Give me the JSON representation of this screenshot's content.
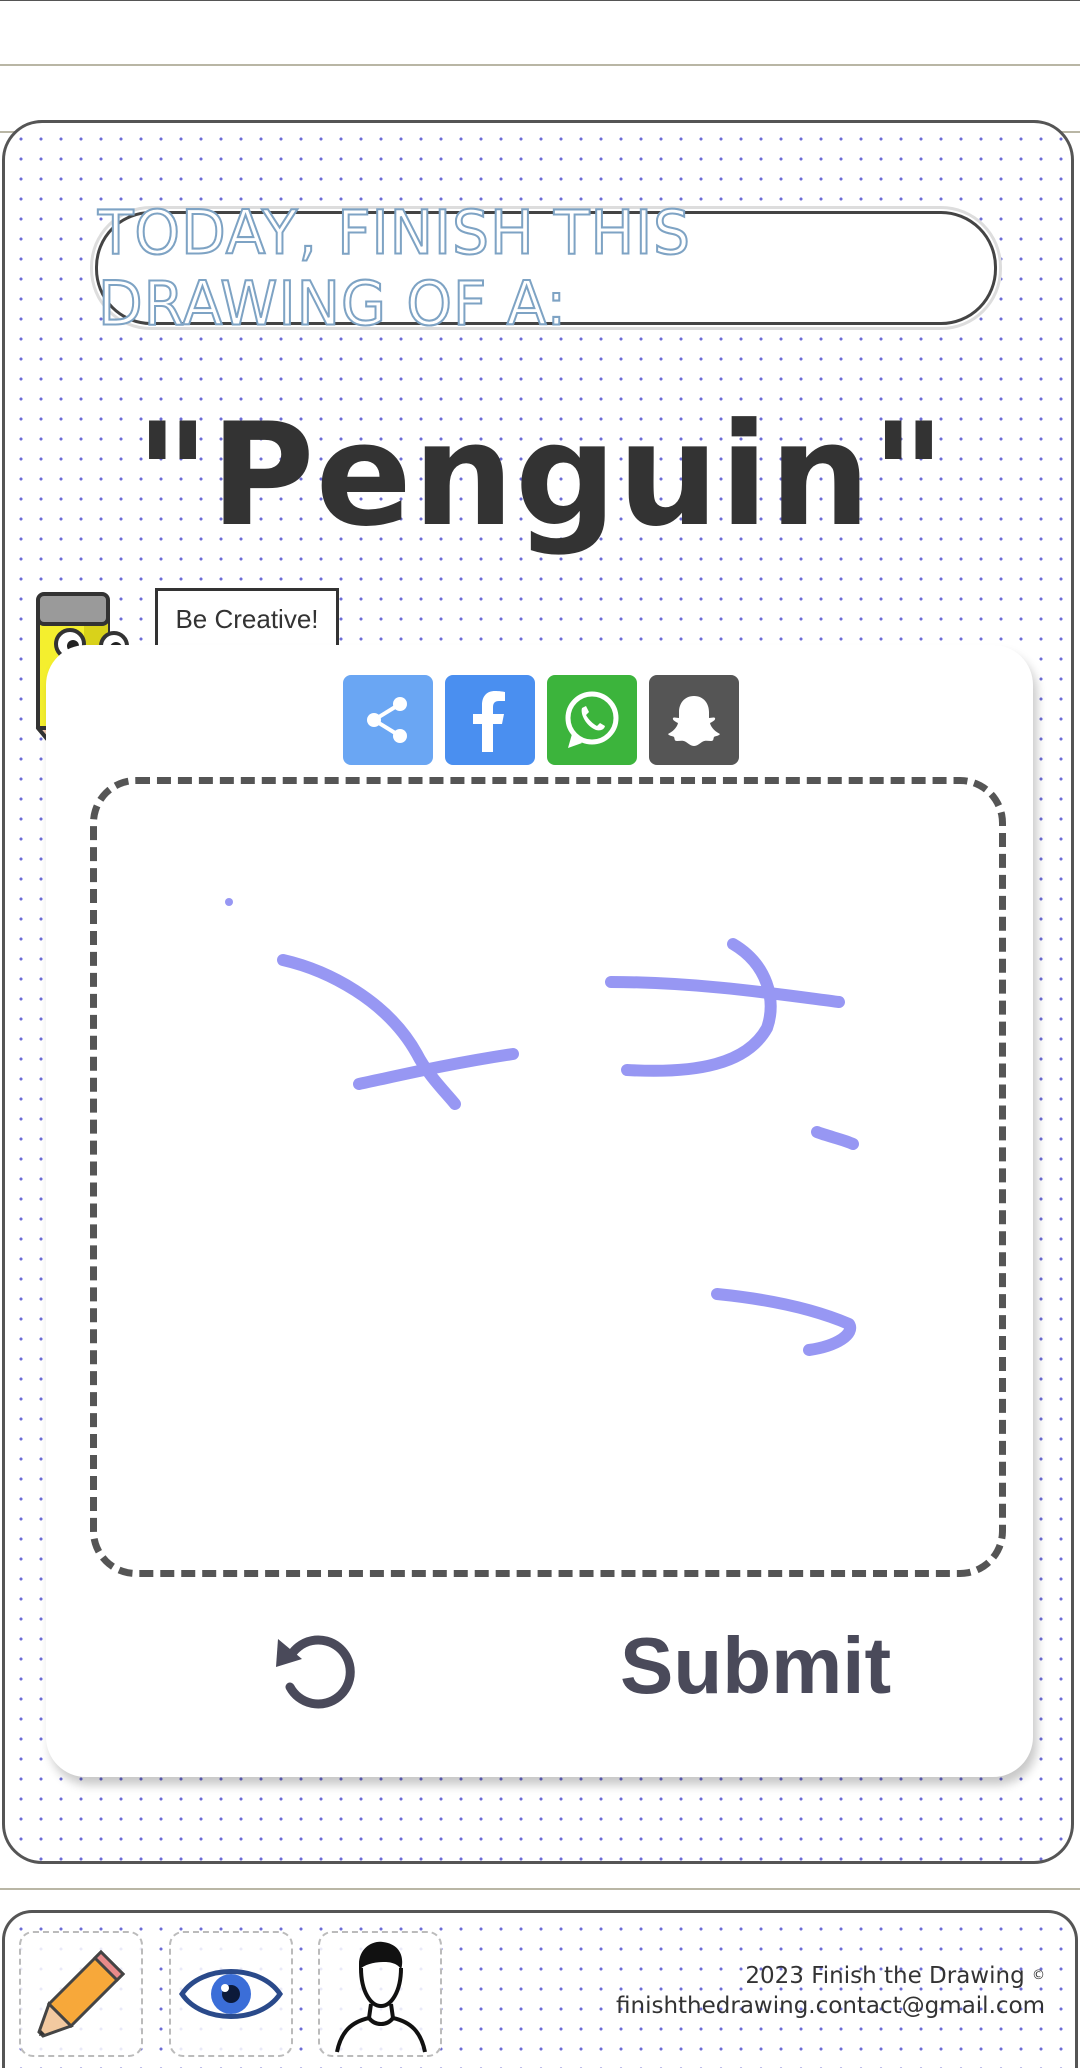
{
  "banner": {
    "text": "TODAY, FINISH THIS DRAWING OF A:"
  },
  "subject": {
    "word": "\"Penguin\""
  },
  "mascot": {
    "bubble": "Be Creative!"
  },
  "share": {
    "buttons": [
      {
        "name": "share",
        "icon": "share-icon",
        "color": "#6aa6f3"
      },
      {
        "name": "facebook",
        "icon": "facebook-icon",
        "color": "#4a8ff0"
      },
      {
        "name": "whatsapp",
        "icon": "whatsapp-icon",
        "color": "#3cb43c"
      },
      {
        "name": "snapchat",
        "icon": "snapchat-icon",
        "color": "#555555"
      }
    ]
  },
  "canvas": {
    "stroke_color": "#8c8cf2"
  },
  "actions": {
    "undo_icon": "undo-icon",
    "submit_label": "Submit"
  },
  "footer": {
    "nav": [
      {
        "name": "draw",
        "icon": "pencil-icon"
      },
      {
        "name": "view",
        "icon": "eye-icon"
      },
      {
        "name": "profile",
        "icon": "person-icon"
      }
    ],
    "copyright": "2023 Finish the Drawing",
    "copyright_symbol": "©",
    "email": "finishthedrawing.contact@gmail.com"
  },
  "colors": {
    "accent_text": "#333333",
    "banner_outline": "#7ea3c4",
    "dots": "#6b6bd6"
  }
}
